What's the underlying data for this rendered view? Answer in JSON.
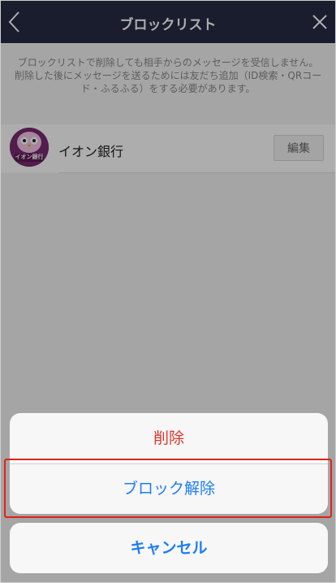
{
  "nav": {
    "title": "ブロックリスト",
    "back_icon": "chevron-left-icon",
    "close_icon": "close-icon"
  },
  "notice": {
    "line1": "ブロックリストで削除しても相手からのメッセージを受信しません。",
    "line2": "削除した後にメッセージを送るためには友だち追加（ID検索・QRコード・ふるふる）をする必要があります。"
  },
  "blocked_list": {
    "items": [
      {
        "name": "イオン銀行",
        "avatar_label": "イオン銀行",
        "edit_label": "編集"
      }
    ]
  },
  "action_sheet": {
    "delete_label": "削除",
    "unblock_label": "ブロック解除",
    "cancel_label": "キャンセル"
  },
  "colors": {
    "nav_bg": "#252c43",
    "destructive": "#e0352d",
    "action_blue": "#1e7df5",
    "highlight": "#e1211c"
  }
}
